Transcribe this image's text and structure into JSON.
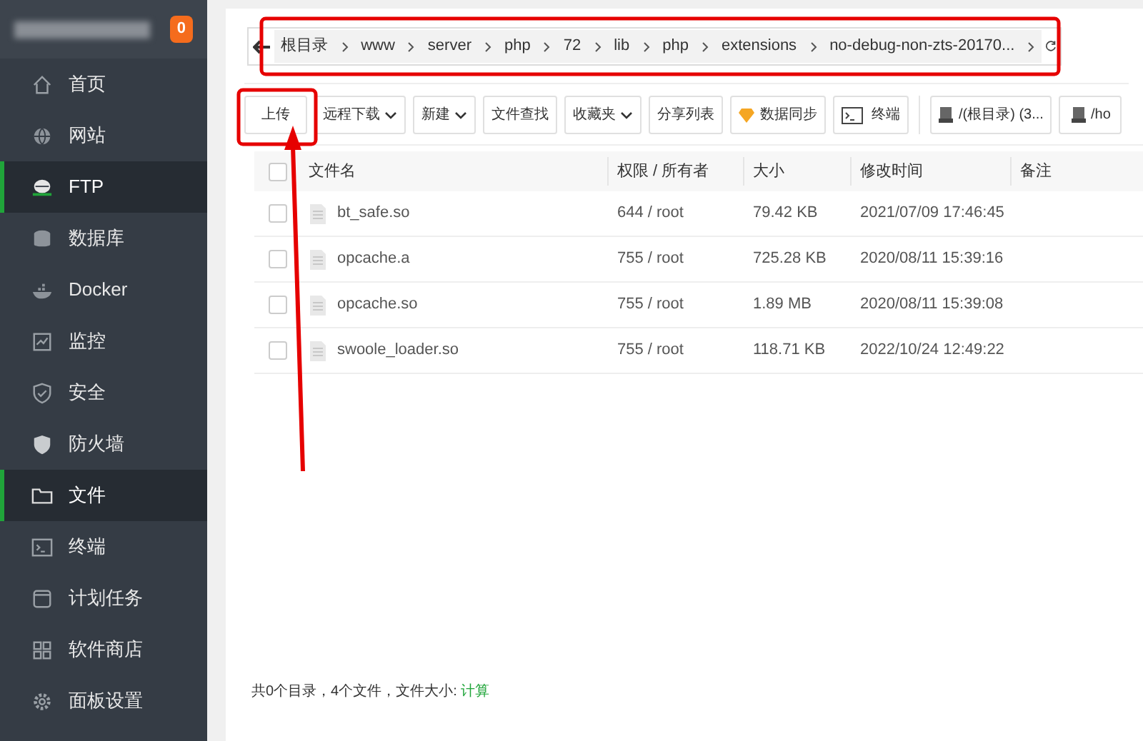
{
  "sidebar": {
    "badge": "0",
    "items": [
      {
        "label": "首页",
        "selected": false
      },
      {
        "label": "网站",
        "selected": false
      },
      {
        "label": "FTP",
        "selected": true
      },
      {
        "label": "数据库",
        "selected": false
      },
      {
        "label": "Docker",
        "selected": false
      },
      {
        "label": "监控",
        "selected": false
      },
      {
        "label": "安全",
        "selected": false
      },
      {
        "label": "防火墙",
        "selected": false
      },
      {
        "label": "文件",
        "selected": true
      },
      {
        "label": "终端",
        "selected": false
      },
      {
        "label": "计划任务",
        "selected": false
      },
      {
        "label": "软件商店",
        "selected": false
      },
      {
        "label": "面板设置",
        "selected": false
      }
    ]
  },
  "breadcrumb": [
    "根目录",
    "www",
    "server",
    "php",
    "72",
    "lib",
    "php",
    "extensions",
    "no-debug-non-zts-20170..."
  ],
  "toolbar": [
    {
      "label": "上传",
      "kind": "plain"
    },
    {
      "label": "远程下载",
      "kind": "dropdown"
    },
    {
      "label": "新建",
      "kind": "dropdown"
    },
    {
      "label": "文件查找",
      "kind": "plain"
    },
    {
      "label": "收藏夹",
      "kind": "dropdown"
    },
    {
      "label": "分享列表",
      "kind": "plain"
    },
    {
      "label": "数据同步",
      "kind": "sync"
    },
    {
      "label": "终端",
      "kind": "terminal"
    },
    {
      "label": "/(根目录) (3...",
      "kind": "disk"
    },
    {
      "label": "/ho",
      "kind": "disk"
    }
  ],
  "table": {
    "select_all_checked": false,
    "columns": [
      "文件名",
      "权限 / 所有者",
      "大小",
      "修改时间",
      "备注"
    ],
    "rows": [
      {
        "checked": false,
        "cells": [
          "bt_safe.so",
          "644 / root",
          "79.42 KB",
          "2021/07/09 17:46:45"
        ]
      },
      {
        "checked": false,
        "cells": [
          "opcache.a",
          "755 / root",
          "725.28 KB",
          "2020/08/11 15:39:16"
        ]
      },
      {
        "checked": false,
        "cells": [
          "opcache.so",
          "755 / root",
          "1.89 MB",
          "2020/08/11 15:39:08"
        ]
      },
      {
        "checked": false,
        "cells": [
          "swoole_loader.so",
          "755 / root",
          "118.71 KB",
          "2022/10/24 12:49:22"
        ]
      }
    ]
  },
  "footer": {
    "summary": "共0个目录，4个文件，文件大小: ",
    "link": "计算"
  }
}
